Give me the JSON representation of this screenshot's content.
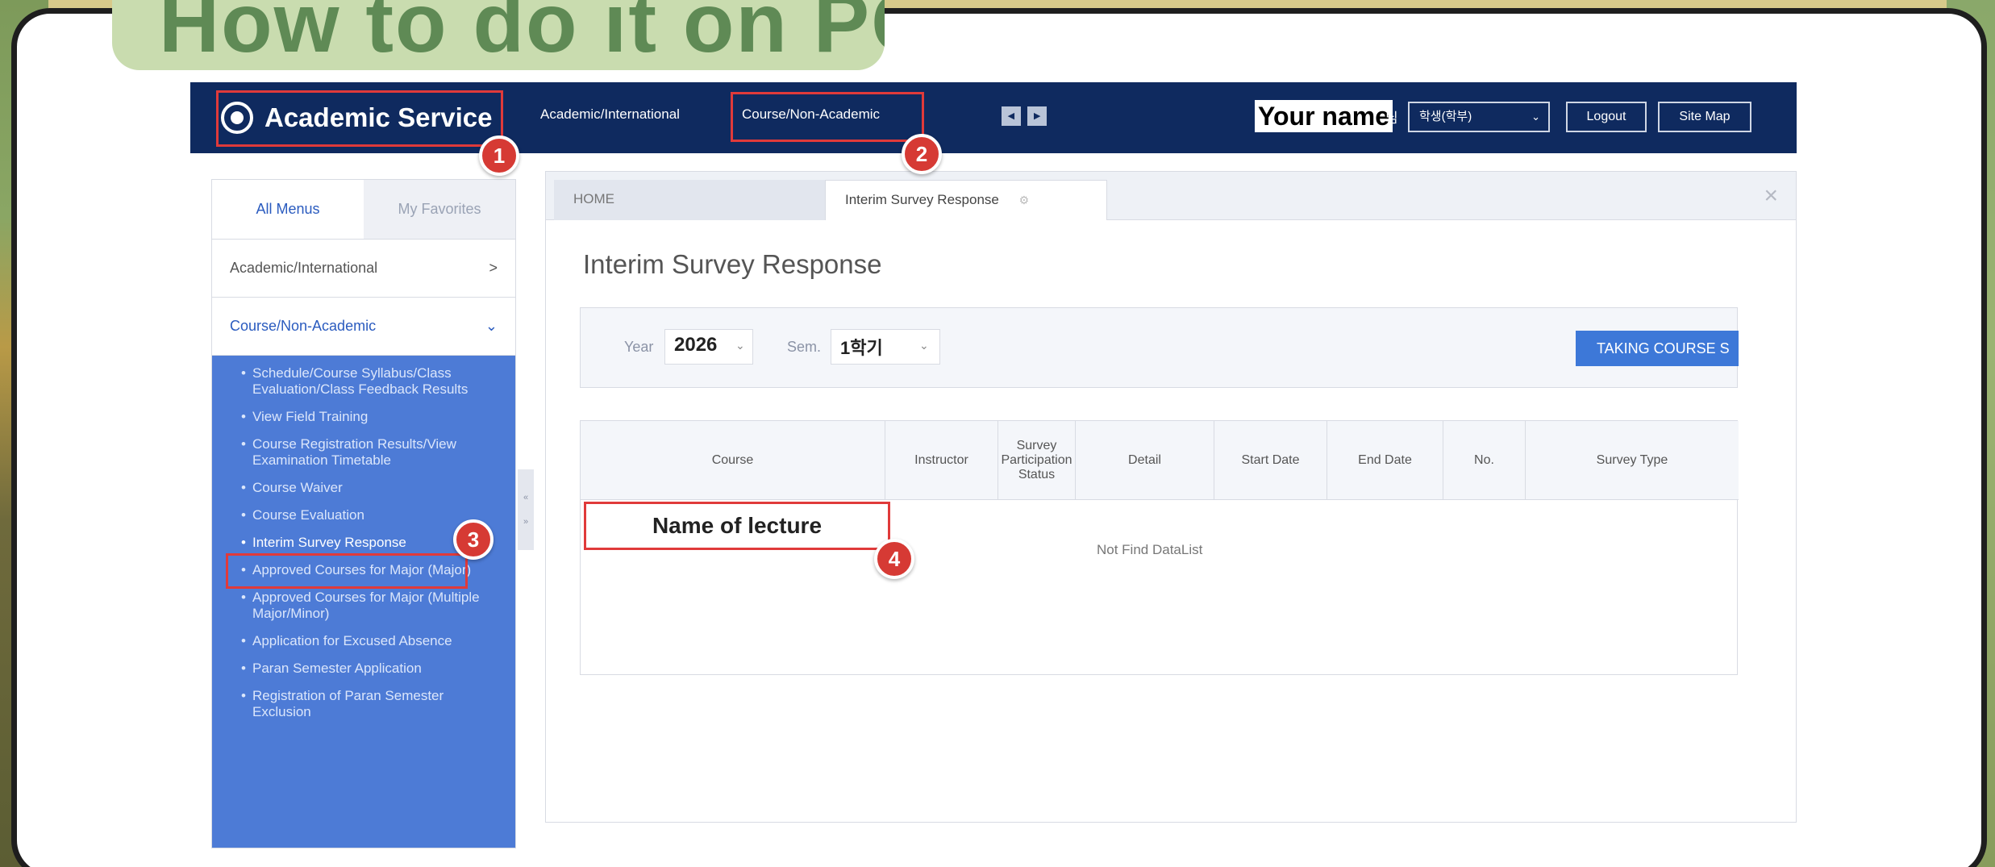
{
  "heading": "How to do it on PC",
  "header": {
    "logo_text": "Academic Service",
    "nav": [
      "Academic/International",
      "Course/Non-Academic"
    ],
    "prev_arrow": "◂",
    "next_arrow": "▸",
    "user_name": "Your name",
    "user_suffix": "님",
    "role_select": "학생(학부)",
    "logout_label": "Logout",
    "sitemap_label": "Site Map"
  },
  "sidebar": {
    "tabs": [
      "All Menus",
      "My Favorites"
    ],
    "groups": [
      {
        "label": "Academic/International",
        "indicator": ">"
      },
      {
        "label": "Course/Non-Academic",
        "indicator": "⌄"
      }
    ],
    "items": [
      "Schedule/Course Syllabus/Class Evaluation/Class Feedback Results",
      "View Field Training",
      "Course Registration Results/View Examination Timetable",
      "Course Waiver",
      "Course Evaluation",
      "Interim Survey Response",
      "Approved Courses for Major (Major)",
      "Approved Courses for Major (Multiple Major/Minor)",
      "Application for Excused Absence",
      "Paran Semester Application",
      "Registration of Paran Semester Exclusion"
    ],
    "selected_index": 5
  },
  "panel": {
    "tabs": {
      "home": "HOME",
      "current": "Interim Survey Response"
    },
    "close_glyph": "×",
    "title": "Interim Survey Response",
    "filter": {
      "year_label": "Year",
      "year_value": "2026",
      "sem_label": "Sem.",
      "sem_value": "1학기",
      "action_button": "TAKING COURSE S"
    },
    "table": {
      "headers": [
        "Course",
        "Instructor",
        "Survey Participation Status",
        "Detail",
        "Start Date",
        "End Date",
        "No.",
        "Survey Type"
      ],
      "empty_text": "Not Find DataList"
    },
    "highlight_label": "Name of lecture"
  },
  "callouts": [
    "1",
    "2",
    "3",
    "4"
  ],
  "colors": {
    "topbar": "#0f2a5f",
    "submenu": "#4d7bd6",
    "callout": "#d63a34",
    "heading_tab": "#c9dcaf"
  }
}
